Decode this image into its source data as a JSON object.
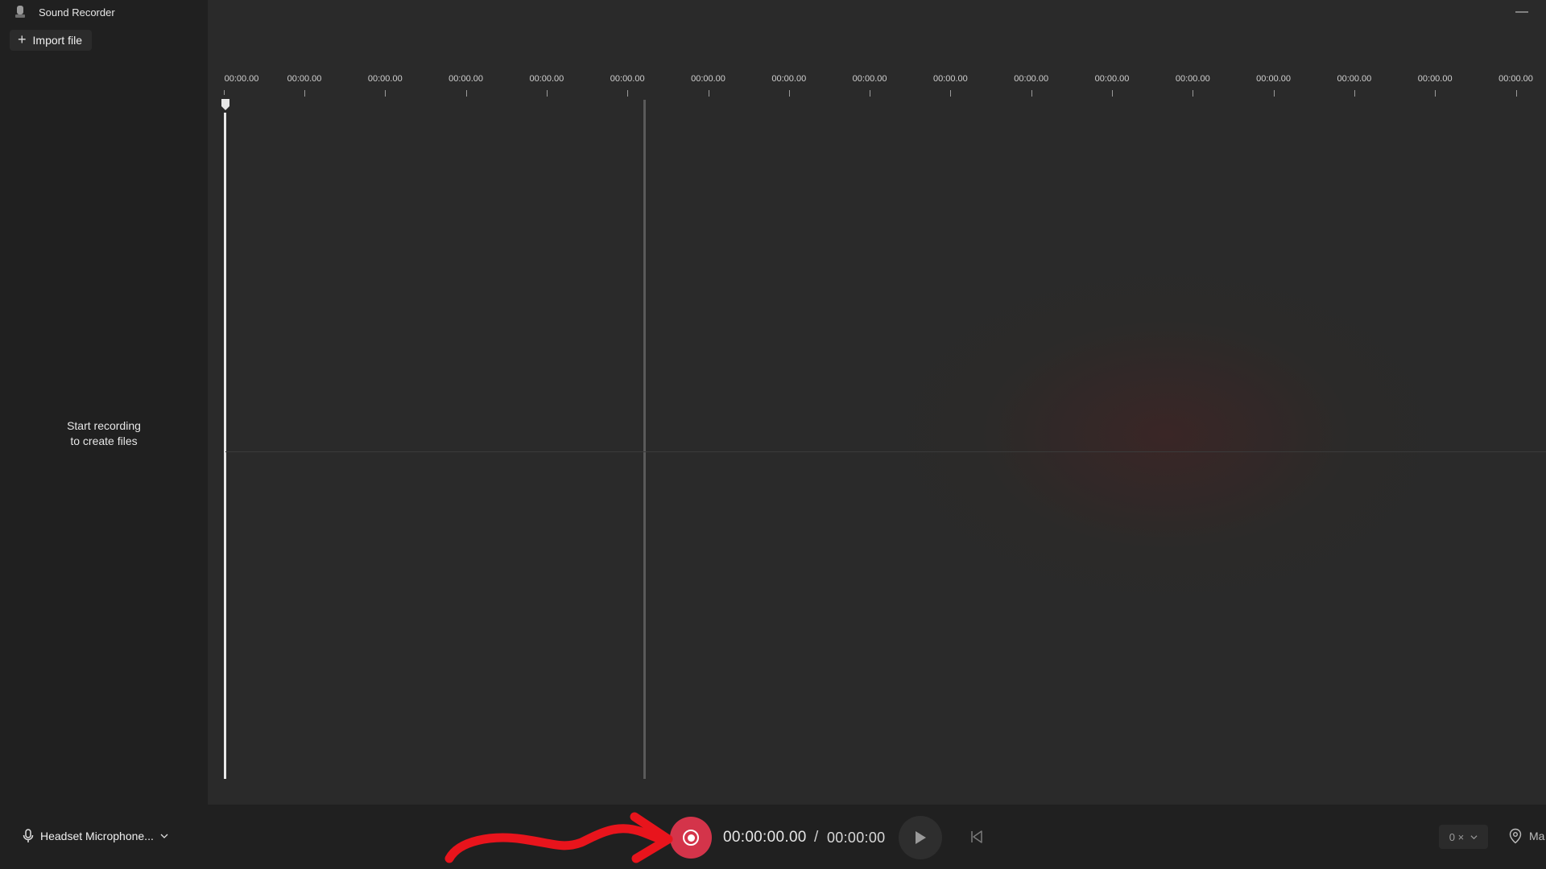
{
  "app": {
    "title": "Sound Recorder"
  },
  "sidebar": {
    "import_label": "Import file",
    "empty_message_line1": "Start recording",
    "empty_message_line2": "to create files"
  },
  "timeline": {
    "ticks": [
      "00:00.00",
      "00:00.00",
      "00:00.00",
      "00:00.00",
      "00:00.00",
      "00:00.00",
      "00:00.00",
      "00:00.00",
      "00:00.00",
      "00:00.00",
      "00:00.00",
      "00:00.00",
      "00:00.00",
      "00:00.00",
      "00:00.00",
      "00:00.00",
      "00:00.00"
    ]
  },
  "controls": {
    "microphone_label": "Headset Microphone...",
    "current_time": "00:00:00.00",
    "separator": "/",
    "total_time": "00:00:00",
    "speed_label": "0 ×",
    "mark_label": "Ma",
    "record_color": "#d4344a"
  },
  "annotation": {
    "arrow_color": "#e8141c"
  }
}
